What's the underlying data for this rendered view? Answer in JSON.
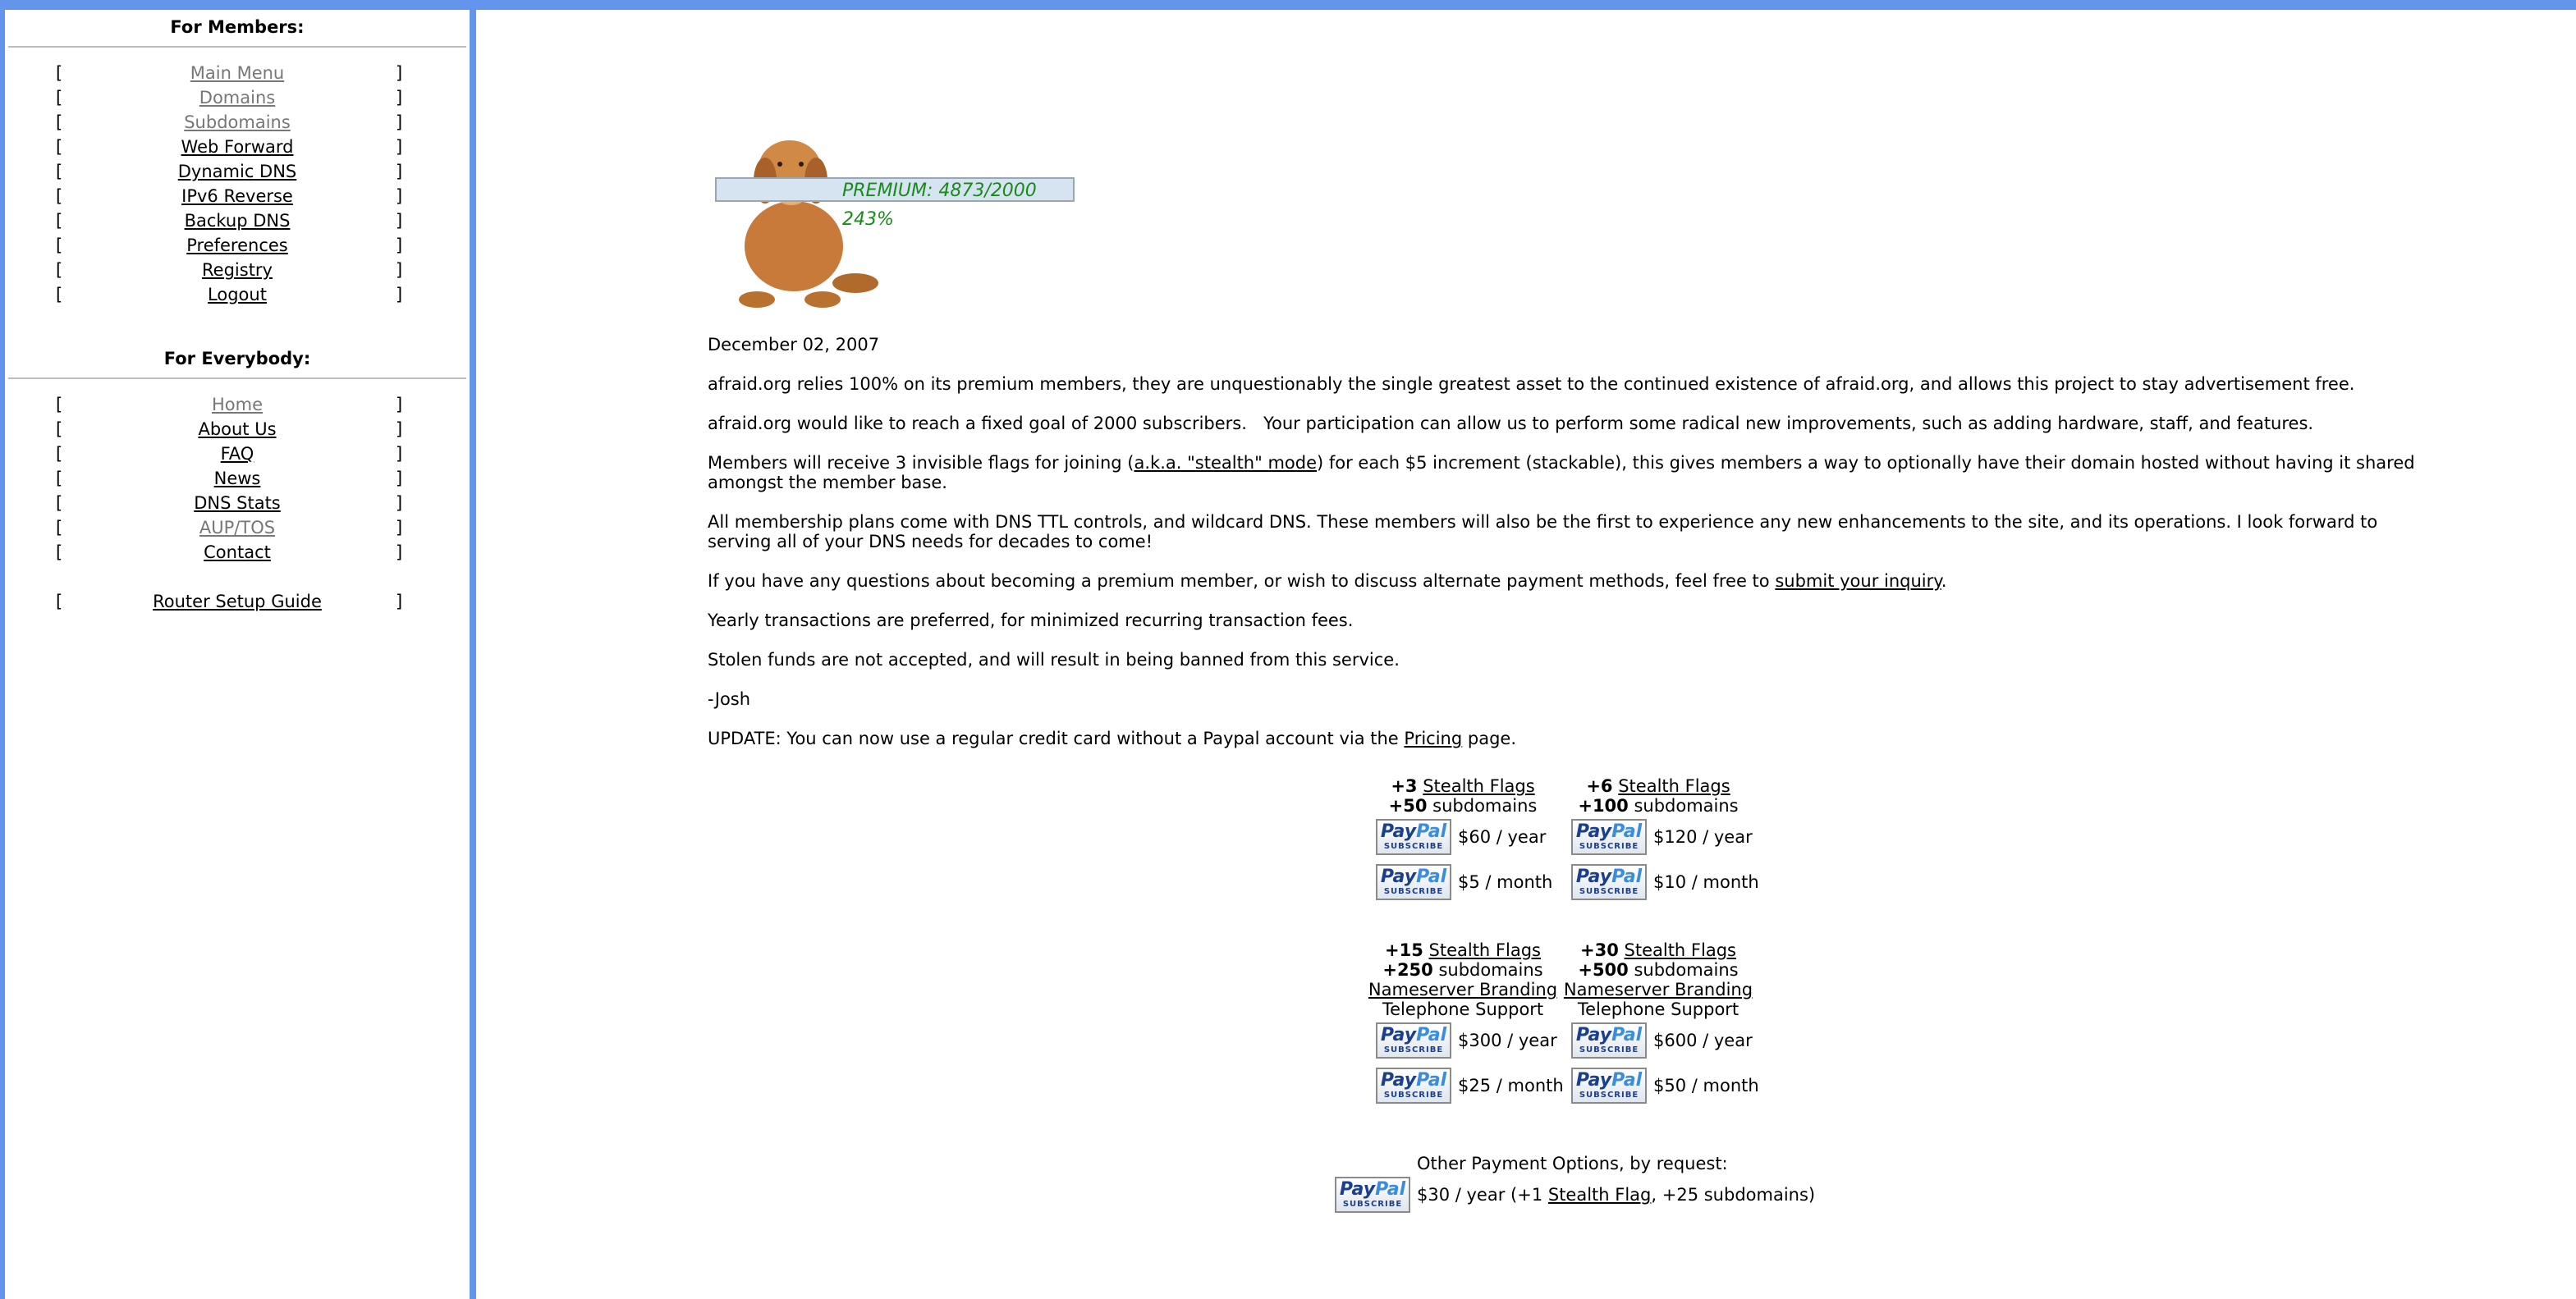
{
  "sidebar": {
    "members_heading": "For Members:",
    "members_items": [
      {
        "label": "Main Menu",
        "dim": true
      },
      {
        "label": "Domains",
        "dim": true
      },
      {
        "label": "Subdomains",
        "dim": true
      },
      {
        "label": "Web Forward",
        "dim": false
      },
      {
        "label": "Dynamic DNS",
        "dim": false
      },
      {
        "label": "IPv6 Reverse",
        "dim": false
      },
      {
        "label": "Backup DNS",
        "dim": false
      },
      {
        "label": "Preferences",
        "dim": false
      },
      {
        "label": "Registry",
        "dim": false
      },
      {
        "label": "Logout",
        "dim": false
      }
    ],
    "everybody_heading": "For Everybody:",
    "everybody_items": [
      {
        "label": "Home",
        "dim": true
      },
      {
        "label": "About Us",
        "dim": false
      },
      {
        "label": "FAQ",
        "dim": false
      },
      {
        "label": "News",
        "dim": false
      },
      {
        "label": "DNS Stats",
        "dim": false
      },
      {
        "label": "AUP/TOS",
        "dim": true
      },
      {
        "label": "Contact",
        "dim": false
      }
    ],
    "router_guide": "Router Setup Guide",
    "bracket_open": "[",
    "bracket_close": "]"
  },
  "banner": {
    "premium_text": "PREMIUM: 4873/2000",
    "percent_text": "243%",
    "goal_fraction": 2.43
  },
  "main": {
    "date": "December 02, 2007",
    "p1": "afraid.org relies 100% on its premium members, they are unquestionably the single greatest asset to the continued existence of afraid.org, and allows this project to stay advertisement free.",
    "p2": "afraid.org would like to reach a fixed goal of 2000 subscribers.   Your participation can allow us to perform some radical new improvements, such as adding hardware, staff, and features.",
    "p3_a": "Members will receive 3 invisible flags for joining (",
    "p3_link": "a.k.a. \"stealth\" mode",
    "p3_b": ") for each $5 increment (stackable), this gives members a way to optionally have their domain hosted without having it shared amongst the member base.",
    "p4": "All membership plans come with DNS TTL controls, and wildcard DNS. These members will also be the first to experience any new enhancements to the site, and its operations. I look forward to serving all of your DNS needs for decades to come!",
    "p5_a": "If you have any questions about becoming a premium member, or wish to discuss alternate payment methods, feel free to ",
    "p5_link": "submit your inquiry",
    "p5_b": ".",
    "p6": "Yearly transactions are preferred, for minimized recurring transaction fees.",
    "p7": "Stolen funds are not accepted, and will result in being banned from this service.",
    "sig": "-Josh",
    "update_a": "UPDATE: You can now use a regular credit card without a Paypal account via the ",
    "update_link": "Pricing",
    "update_b": " page."
  },
  "paypal": {
    "pay": "Pay",
    "pal": "Pal",
    "sub": "SUBSCRIBE"
  },
  "plans": {
    "stealth_flags": "Stealth Flags",
    "subdomains": "subdomains",
    "ns_branding": "Nameserver Branding",
    "phone": "Telephone Support",
    "p1": {
      "flags": "+3",
      "subs": "+50",
      "year": "$60 / year",
      "month": "$5 / month"
    },
    "p2": {
      "flags": "+6",
      "subs": "+100",
      "year": "$120 / year",
      "month": "$10 / month"
    },
    "p3": {
      "flags": "+15",
      "subs": "+250",
      "year": "$300 / year",
      "month": "$25 / month"
    },
    "p4": {
      "flags": "+30",
      "subs": "+500",
      "year": "$600 / year",
      "month": "$50 / month"
    }
  },
  "other": {
    "heading": "Other Payment Options, by request:",
    "price_a": "$30 / year (+1 ",
    "price_link": "Stealth Flag",
    "price_b": ", +25 subdomains)"
  }
}
